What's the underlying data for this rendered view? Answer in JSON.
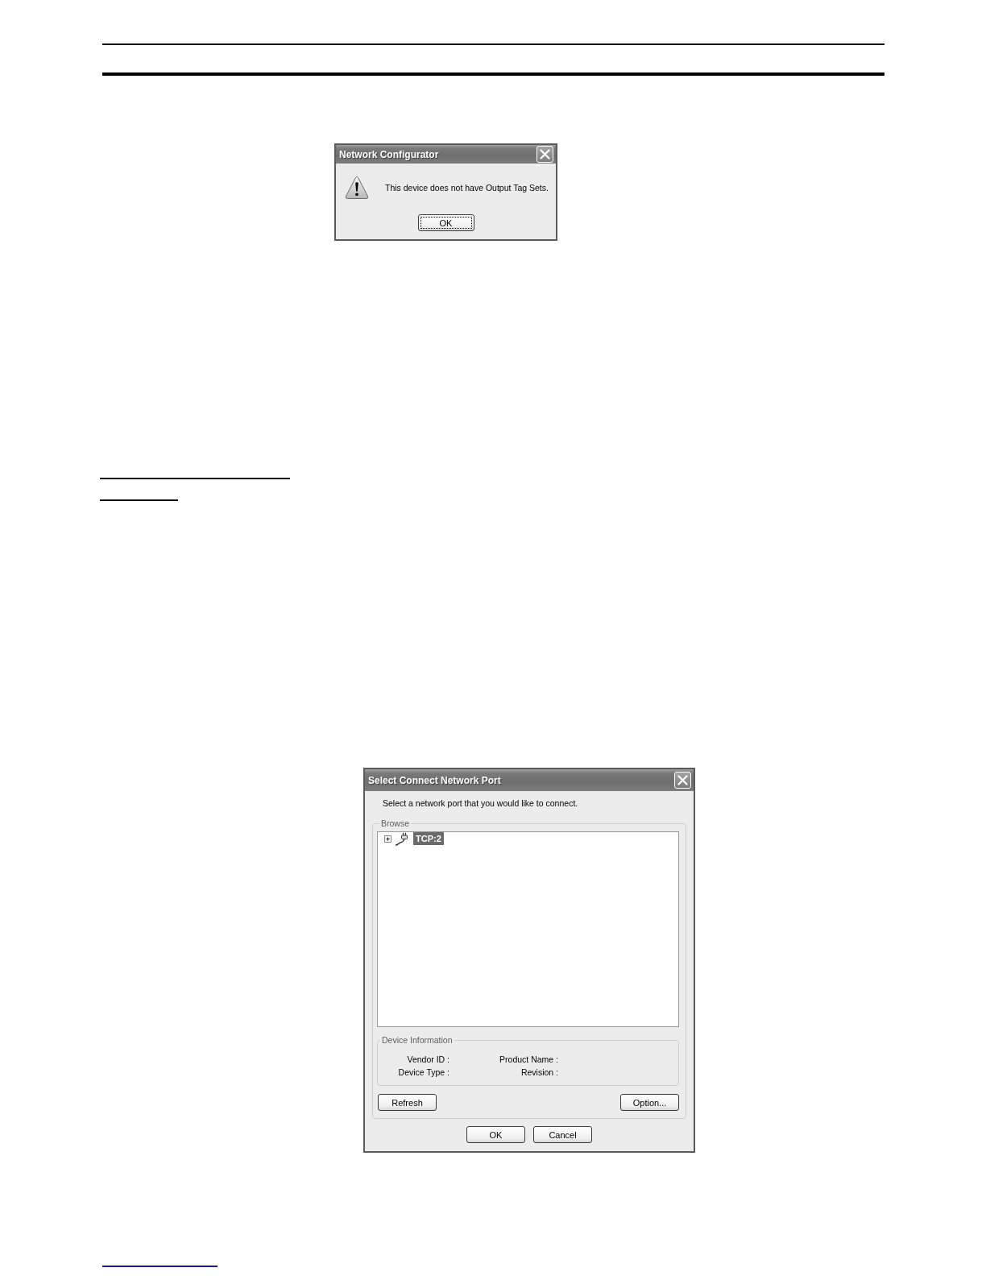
{
  "message_dialog": {
    "title": "Network Configurator",
    "message": "This device does not have Output Tag Sets.",
    "buttons": [
      {
        "label": "OK",
        "focused": true
      }
    ]
  },
  "port_dialog": {
    "title": "Select Connect Network Port",
    "instruction": "Select a network port that you would like to connect.",
    "browse": {
      "legend": "Browse",
      "tree": [
        {
          "label": "TCP:2",
          "expanded": false,
          "selected": true
        }
      ],
      "device_information": {
        "legend": "Device Information",
        "fields": [
          "Vendor ID :",
          "Product Name :",
          "Device Type :",
          "Revision :"
        ]
      },
      "buttons": [
        "Refresh",
        "Option..."
      ]
    },
    "buttons": [
      "OK",
      "Cancel"
    ]
  }
}
